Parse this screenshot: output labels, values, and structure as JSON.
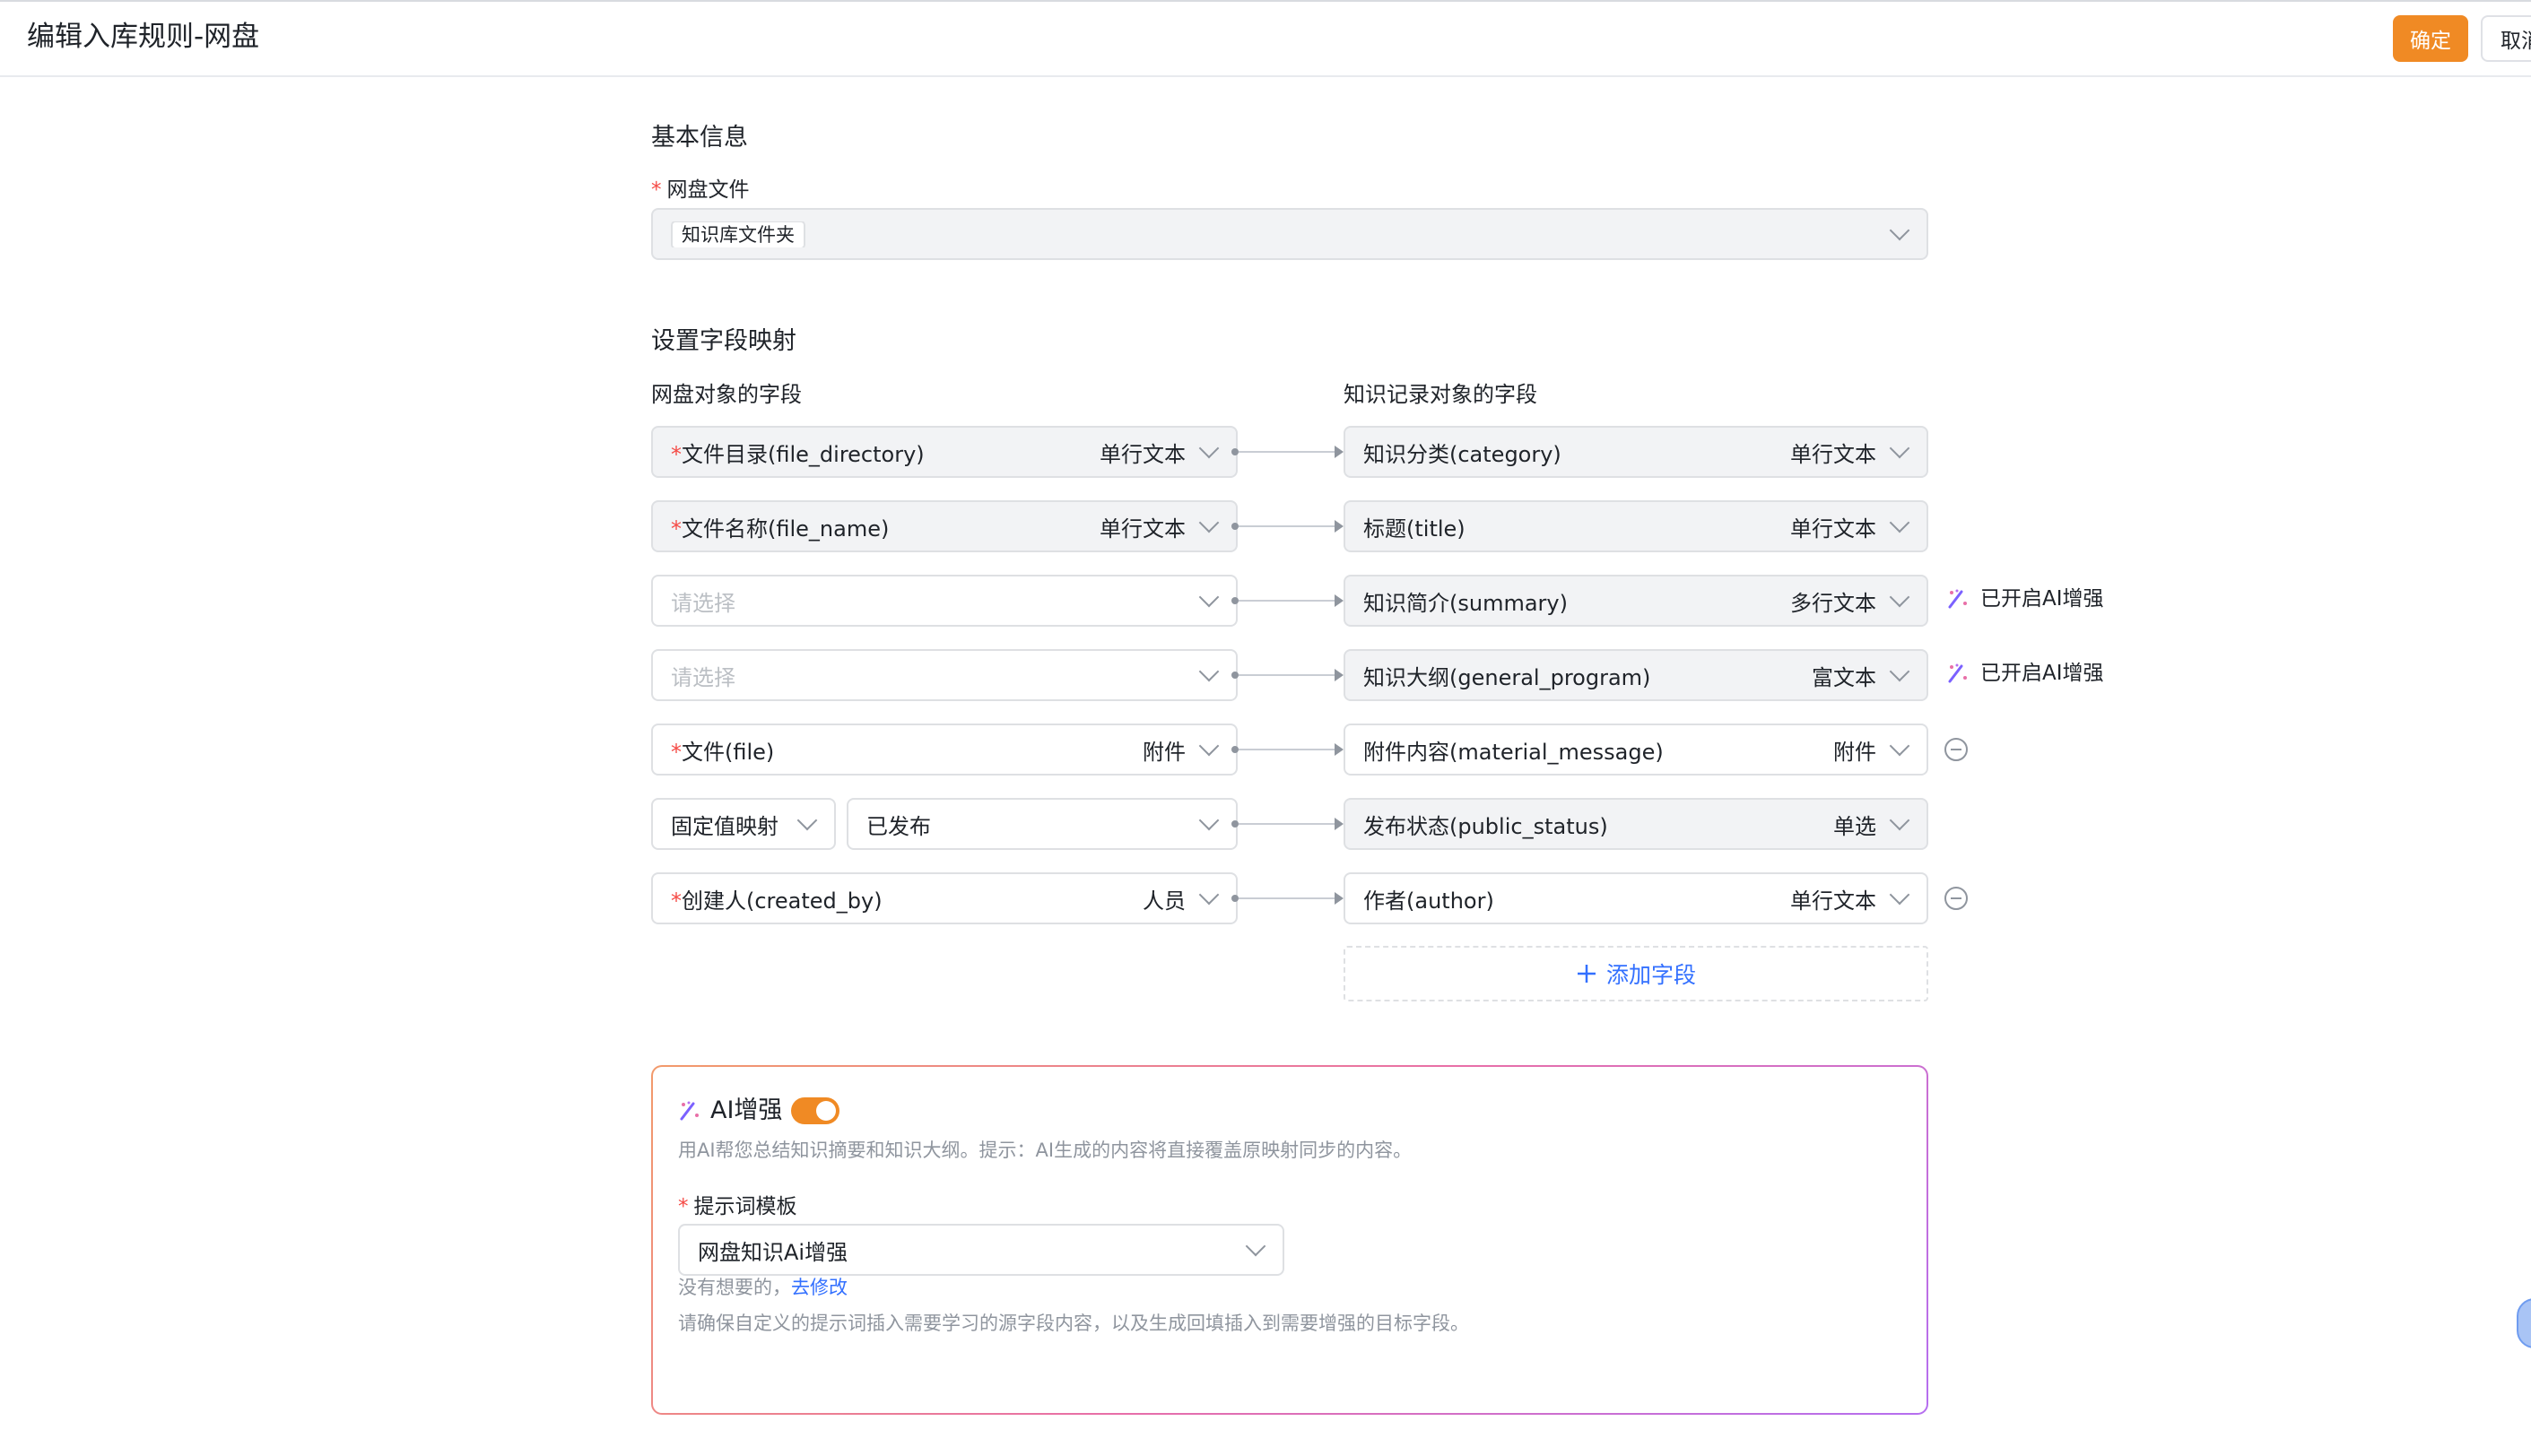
{
  "window": {
    "title": "编辑入库规则-网盘"
  },
  "header": {
    "confirm_label": "确定",
    "cancel_label": "取消"
  },
  "basic": {
    "section_title": "基本信息",
    "netdisk_label": "网盘文件",
    "netdisk_value": "知识库文件夹"
  },
  "mapping": {
    "section_title": "设置字段映射",
    "left_title": "网盘对象的字段",
    "right_title": "知识记录对象的字段",
    "placeholder": "请选择",
    "rows": [
      {
        "left": "文件目录(file_directory)",
        "left_required": true,
        "left_type": "单行文本",
        "right": "知识分类(category)",
        "right_type": "单行文本",
        "extra": ""
      },
      {
        "left": "文件名称(file_name)",
        "left_required": true,
        "left_type": "单行文本",
        "right": "标题(title)",
        "right_type": "单行文本",
        "extra": ""
      },
      {
        "left": "",
        "left_required": false,
        "left_type": "",
        "right": "知识简介(summary)",
        "right_type": "多行文本",
        "extra": "已开启AI增强"
      },
      {
        "left": "",
        "left_required": false,
        "left_type": "",
        "right": "知识大纲(general_program)",
        "right_type": "富文本",
        "extra": "已开启AI增强"
      },
      {
        "left": "文件(file)",
        "left_required": true,
        "left_type": "附件",
        "right": "附件内容(material_message)",
        "right_type": "附件",
        "extra": "remove"
      },
      {
        "left_mode": "固定值映射",
        "left_value": "已发布",
        "right": "发布状态(public_status)",
        "right_type": "单选",
        "extra": ""
      },
      {
        "left": "创建人(created_by)",
        "left_required": true,
        "left_type": "人员",
        "right": "作者(author)",
        "right_type": "单行文本",
        "extra": "remove"
      }
    ],
    "add_field_label": "添加字段"
  },
  "ai": {
    "title": "AI增强",
    "enabled": true,
    "description": "用AI帮您总结知识摘要和知识大纲。提示：AI生成的内容将直接覆盖原映射同步的内容。",
    "prompt_label": "提示词模板",
    "prompt_value": "网盘知识Ai增强",
    "hint_prefix": "没有想要的，",
    "hint_link": "去修改",
    "hint_note": "请确保自定义的提示词插入需要学习的源字段内容，以及生成回填插入到需要增强的目标字段。"
  },
  "colors": {
    "accent": "#f08a24",
    "link": "#3370ff",
    "required": "#f54a45"
  },
  "icons": {
    "ai": "magic-wand-icon",
    "chevron": "chevron-down-icon",
    "remove": "minus-circle-icon",
    "add": "plus-icon"
  }
}
